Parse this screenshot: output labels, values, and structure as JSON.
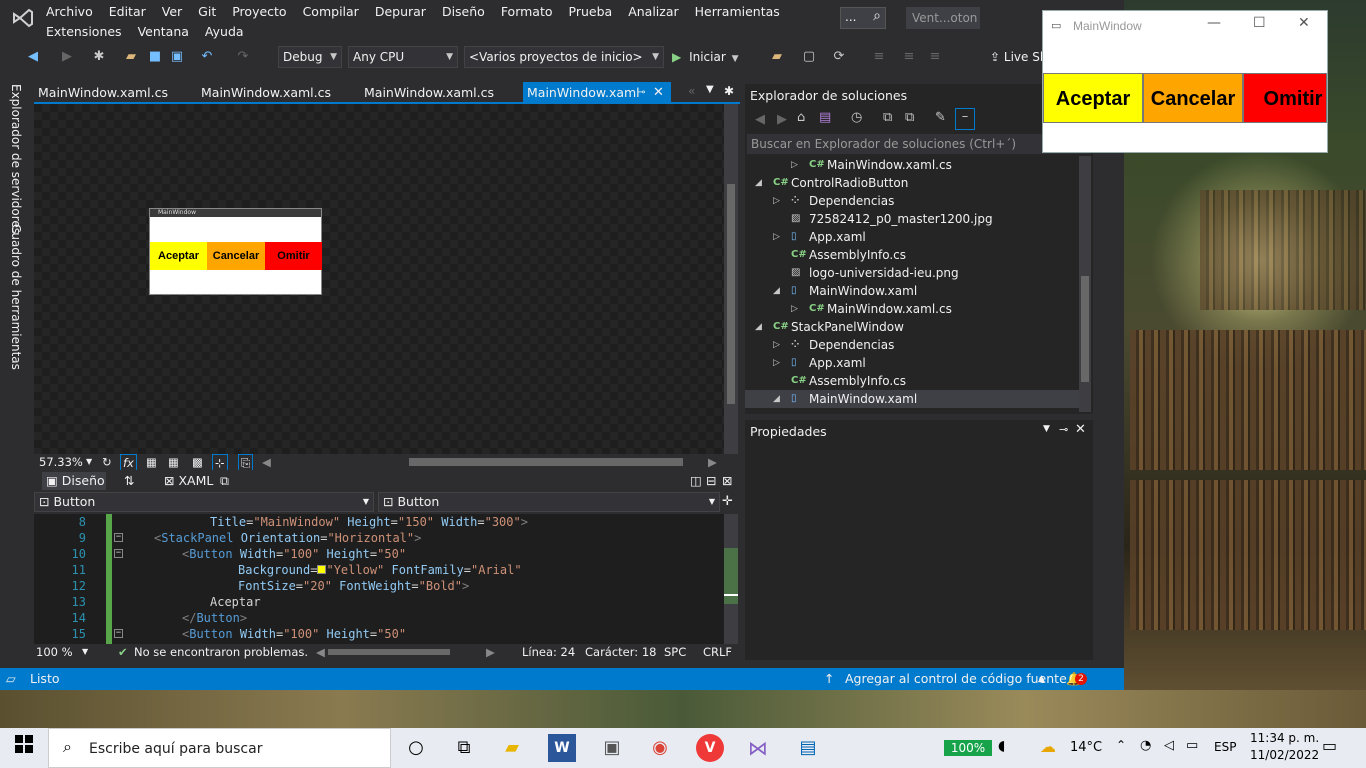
{
  "menu": [
    "Archivo",
    "Editar",
    "Ver",
    "Git",
    "Proyecto",
    "Compilar",
    "Depurar",
    "Diseño",
    "Formato",
    "Prueba",
    "Analizar",
    "Herramientas",
    "Extensiones",
    "Ventana",
    "Ayuda"
  ],
  "search_placeholder": "...",
  "solution_short_name": "Vent...oton",
  "toolbar": {
    "config": "Debug",
    "platform": "Any CPU",
    "startup": "<Varios proyectos de inicio>",
    "start_label": "Iniciar",
    "live_share": "Live Sh"
  },
  "tabs": [
    {
      "label": "MainWindow.xaml.cs"
    },
    {
      "label": "MainWindow.xaml.cs"
    },
    {
      "label": "MainWindow.xaml.cs"
    },
    {
      "label": "MainWindow.xaml",
      "active": true
    }
  ],
  "side_panels": {
    "servers": "Explorador de servidores",
    "toolbox": "Cuadro de herramientas"
  },
  "designer": {
    "zoom": "57.33%",
    "mini_window_title": "MainWindow",
    "buttons": [
      {
        "label": "Aceptar",
        "color": "#ffff00"
      },
      {
        "label": "Cancelar",
        "color": "#ffa500"
      },
      {
        "label": "Omitir",
        "color": "#ff0000"
      }
    ]
  },
  "split_tabs": {
    "design": "Diseño",
    "xaml": "XAML"
  },
  "element_selectors": {
    "left": "Button",
    "right": "Button"
  },
  "code_lines": [
    {
      "n": "8",
      "html": "<span class='a'>Title</span><span class='t'>=</span><span class='v'>\"MainWindow\"</span> <span class='a'>Height</span><span class='t'>=</span><span class='v'>\"150\"</span> <span class='a'>Width</span><span class='t'>=</span><span class='v'>\"300\"</span><span class='b'>&gt;</span>",
      "indent": 2
    },
    {
      "n": "9",
      "html": "<span class='b'>&lt;</span><span class='k'>StackPanel</span> <span class='a'>Orientation</span><span class='t'>=</span><span class='v'>\"Horizontal\"</span><span class='b'>&gt;</span>",
      "indent": 0
    },
    {
      "n": "10",
      "html": "<span class='b'>&lt;</span><span class='k'>Button</span> <span class='a'>Width</span><span class='t'>=</span><span class='v'>\"100\"</span> <span class='a'>Height</span><span class='t'>=</span><span class='v'>\"50\"</span>",
      "indent": 1
    },
    {
      "n": "11",
      "html": "<span class='a'>Background</span><span class='t'>=</span><span style='display:inline-block;width:9px;height:9px;background:#ff0;border:1px solid #888'></span><span class='v'>\"Yellow\"</span> <span class='a'>FontFamily</span><span class='t'>=</span><span class='v'>\"Arial\"</span>",
      "indent": 3
    },
    {
      "n": "12",
      "html": "<span class='a'>FontSize</span><span class='t'>=</span><span class='v'>\"20\"</span> <span class='a'>FontWeight</span><span class='t'>=</span><span class='v'>\"Bold\"</span><span class='b'>&gt;</span>",
      "indent": 3
    },
    {
      "n": "13",
      "html": "<span class='t'>Aceptar</span>",
      "indent": 2
    },
    {
      "n": "14",
      "html": "<span class='b'>&lt;/</span><span class='k'>Button</span><span class='b'>&gt;</span>",
      "indent": 1
    },
    {
      "n": "15",
      "html": "<span class='b'>&lt;</span><span class='k'>Button</span> <span class='a'>Width</span><span class='t'>=</span><span class='v'>\"100\"</span> <span class='a'>Height</span><span class='t'>=</span><span class='v'>\"50\"</span>",
      "indent": 1
    }
  ],
  "editor_status": {
    "zoom": "100 %",
    "problems": "No se encontraron problemas.",
    "line": "Línea: 24",
    "char": "Carácter: 18",
    "spc": "SPC",
    "crlf": "CRLF"
  },
  "solution_explorer": {
    "title": "Explorador de soluciones",
    "search": "Buscar en Explorador de soluciones (Ctrl+´)",
    "items": [
      {
        "label": "MainWindow.xaml.cs",
        "level": 3,
        "icon": "C#",
        "twisty": "▷"
      },
      {
        "label": "ControlRadioButton",
        "level": 1,
        "icon": "C#",
        "twisty": "◢"
      },
      {
        "label": "Dependencias",
        "level": 2,
        "icon": "dep",
        "twisty": "▷"
      },
      {
        "label": "72582412_p0_master1200.jpg",
        "level": 2,
        "icon": "img",
        "twisty": ""
      },
      {
        "label": "App.xaml",
        "level": 2,
        "icon": "xaml",
        "twisty": "▷"
      },
      {
        "label": "AssemblyInfo.cs",
        "level": 2,
        "icon": "C#",
        "twisty": ""
      },
      {
        "label": "logo-universidad-ieu.png",
        "level": 2,
        "icon": "img",
        "twisty": ""
      },
      {
        "label": "MainWindow.xaml",
        "level": 2,
        "icon": "xaml",
        "twisty": "◢"
      },
      {
        "label": "MainWindow.xaml.cs",
        "level": 3,
        "icon": "C#",
        "twisty": "▷"
      },
      {
        "label": "StackPanelWindow",
        "level": 1,
        "icon": "C#",
        "twisty": "◢"
      },
      {
        "label": "Dependencias",
        "level": 2,
        "icon": "dep",
        "twisty": "▷"
      },
      {
        "label": "App.xaml",
        "level": 2,
        "icon": "xaml",
        "twisty": "▷"
      },
      {
        "label": "AssemblyInfo.cs",
        "level": 2,
        "icon": "C#",
        "twisty": ""
      },
      {
        "label": "MainWindow.xaml",
        "level": 2,
        "icon": "xaml",
        "twisty": "◢",
        "selected": true
      }
    ]
  },
  "properties": {
    "title": "Propiedades"
  },
  "statusbar": {
    "ready": "Listo",
    "source_control": "Agregar al control de código fuente",
    "notifications": "2"
  },
  "wpf_window": {
    "title": "MainWindow",
    "buttons": [
      {
        "label": "Aceptar",
        "color": "#ffff00"
      },
      {
        "label": "Cancelar",
        "color": "#ffa500"
      },
      {
        "label": "Omitir",
        "color": "#ff0000"
      }
    ]
  },
  "taskbar": {
    "search_placeholder": "Escribe aquí para buscar",
    "battery": "100%",
    "weather": "14°C",
    "lang": "ESP",
    "time": "11:34 p. m.",
    "date": "11/02/2022"
  }
}
